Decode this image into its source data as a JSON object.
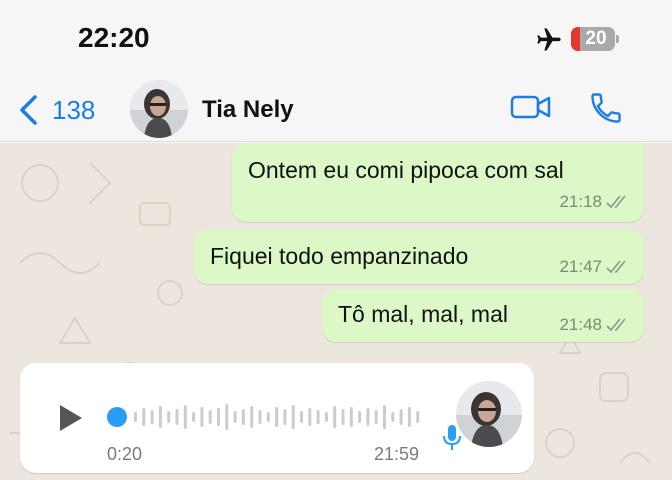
{
  "status": {
    "time": "22:20",
    "battery": "20",
    "battery_level": 0.2
  },
  "header": {
    "back_count": "138",
    "contact_name": "Tia Nely"
  },
  "messages": [
    {
      "text": "Ontem eu comi pipoca com sal",
      "time": "21:18",
      "status": "read"
    },
    {
      "text": "Fiquei todo empanzinado",
      "time": "21:47",
      "status": "read"
    },
    {
      "text": "Tô mal, mal, mal",
      "time": "21:48",
      "status": "read"
    }
  ],
  "voice_message": {
    "duration": "0:20",
    "time": "21:59",
    "progress": 0
  },
  "icons": {
    "airplane": "airplane-icon",
    "back": "chevron-left-icon",
    "video": "video-camera-icon",
    "call": "phone-icon",
    "play": "play-icon",
    "mic": "microphone-icon",
    "read": "double-check-icon"
  },
  "colors": {
    "accent": "#1a7ee8",
    "outgoing_bubble": "#dcf8c6",
    "incoming_bubble": "#ffffff",
    "chat_background": "#ede6df",
    "battery_low": "#e5372f",
    "voice_progress": "#2a9df4"
  }
}
